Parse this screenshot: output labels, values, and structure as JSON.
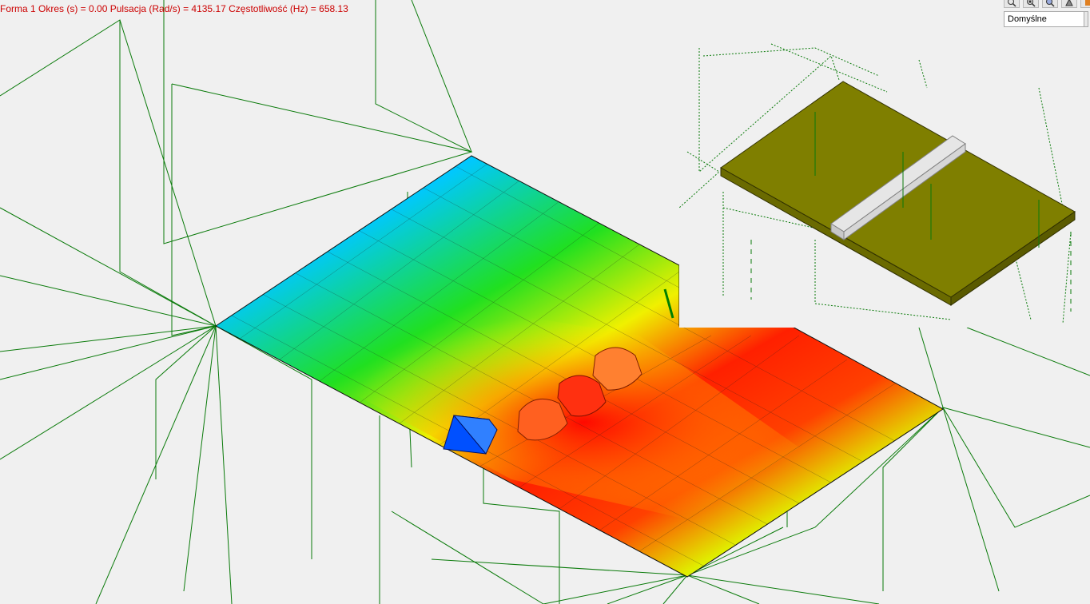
{
  "status": {
    "mode_label": "Forma 1",
    "period_label": "Okres (s)",
    "period_value": "0.00",
    "pulsation_label": "Pulsacja (Rad/s)",
    "pulsation_value": "4135.17",
    "frequency_label": "Częstotliwość (Hz)",
    "frequency_value": "658.13",
    "full_text": "Forma 1  Okres (s) = 0.00  Pulsacja (Rad/s) = 4135.17  Częstotliwość (Hz) = 658.13"
  },
  "toolbar": {
    "buttons": [
      {
        "icon": "zoom-icon"
      },
      {
        "icon": "zoom-region-icon"
      },
      {
        "icon": "zoom-extents-icon"
      },
      {
        "icon": "pan-icon"
      },
      {
        "icon": "color-icon"
      }
    ]
  },
  "view_select": {
    "value": "Domyślne"
  },
  "colors": {
    "background": "#f0f0f0",
    "wireframe": "#0a7a0a",
    "status_text": "#cc0000",
    "preview_slab": "#7f7f00",
    "preview_beam": "#e4e4e4",
    "contour_low": "#0033ff",
    "contour_high": "#ff0000"
  }
}
